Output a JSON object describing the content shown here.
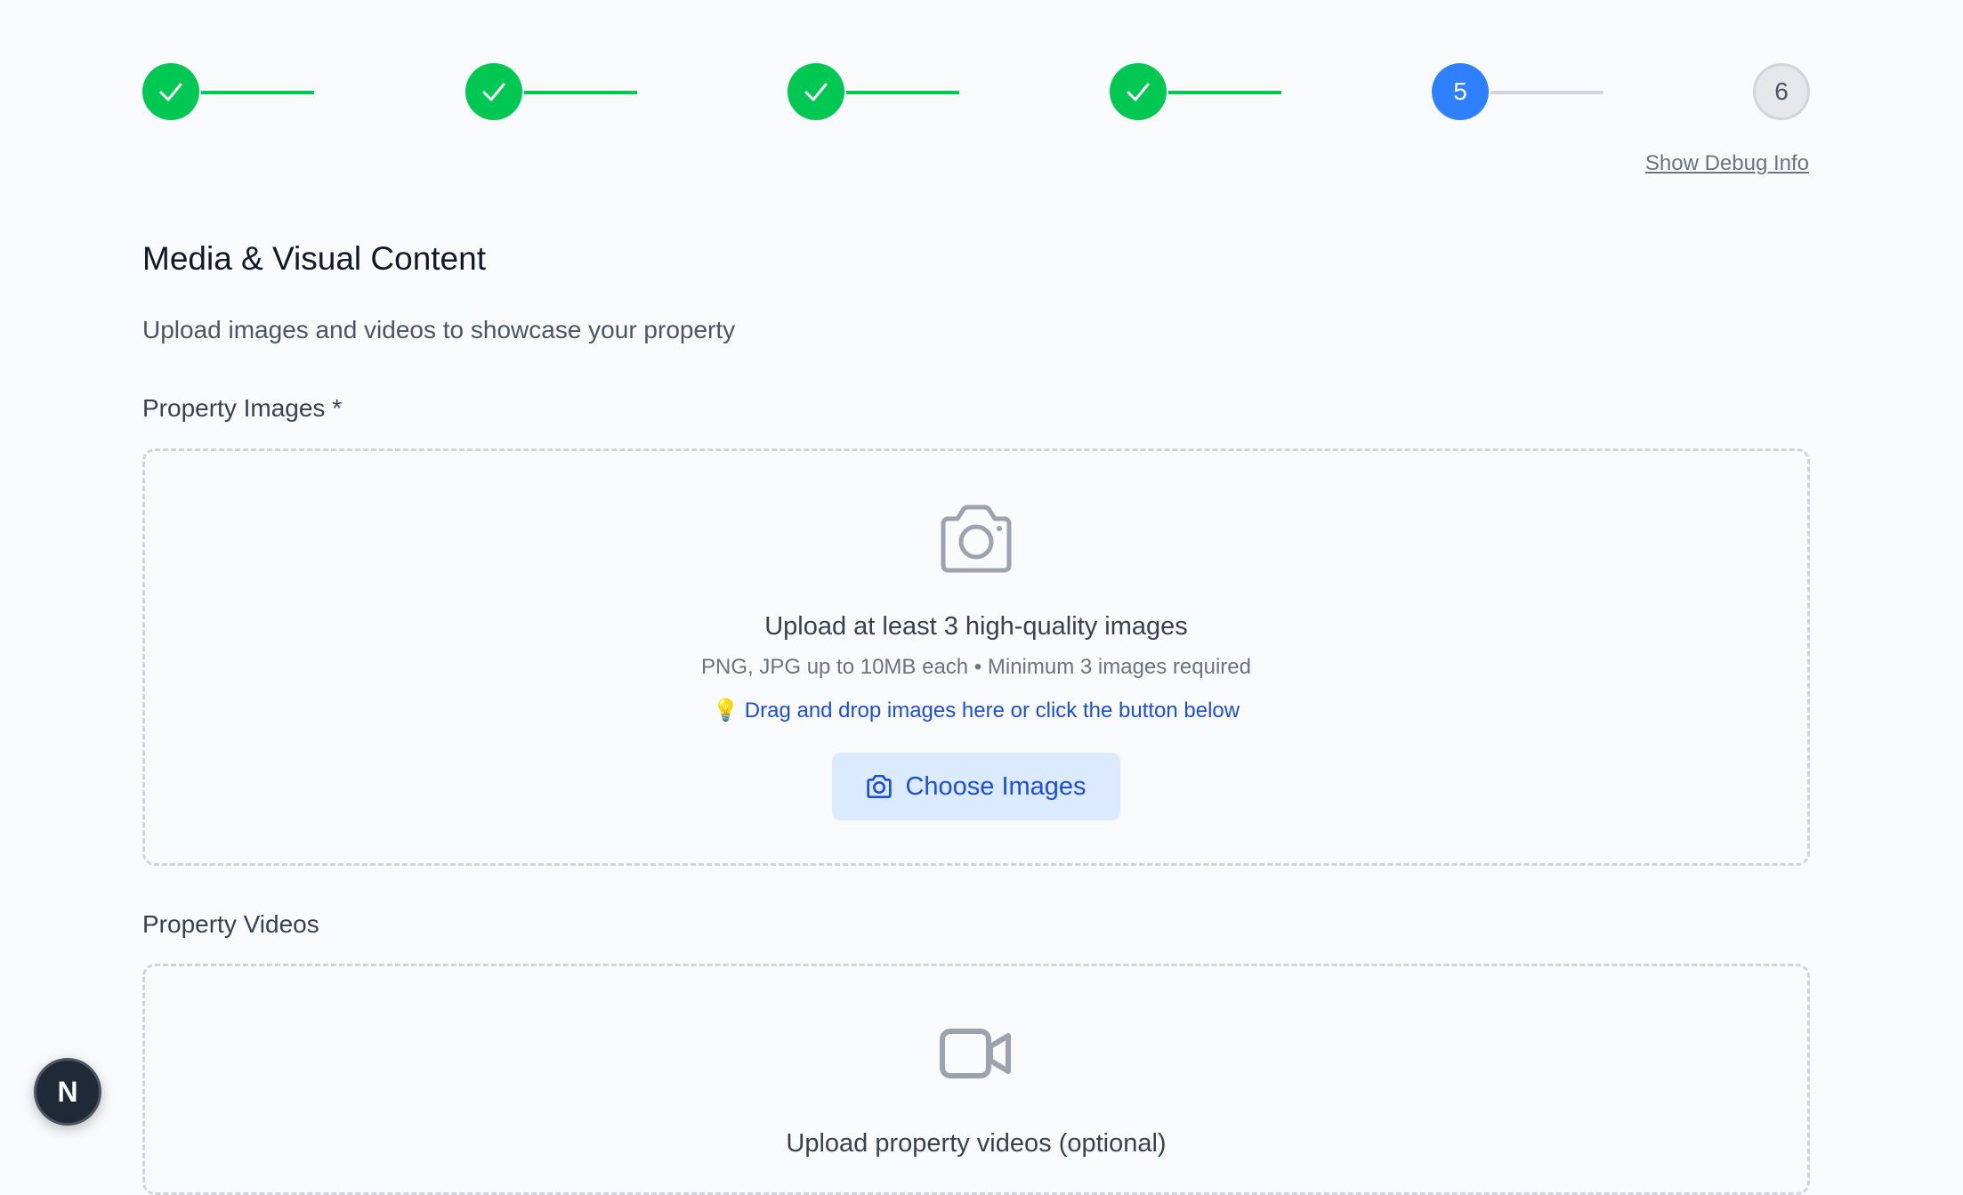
{
  "stepper": {
    "steps": [
      {
        "status": "done",
        "label": ""
      },
      {
        "status": "done",
        "label": ""
      },
      {
        "status": "done",
        "label": ""
      },
      {
        "status": "done",
        "label": ""
      },
      {
        "status": "active",
        "label": "5"
      },
      {
        "status": "pending",
        "label": "6"
      }
    ],
    "debug_link": "Show Debug Info"
  },
  "section": {
    "title": "Media & Visual Content",
    "description": "Upload images and videos to showcase your property"
  },
  "images": {
    "label": "Property Images *",
    "icon": "camera-icon",
    "title": "Upload at least 3 high-quality images",
    "subtitle": "PNG, JPG up to 10MB each • Minimum 3 images required",
    "hint_icon": "💡",
    "hint": "Drag and drop images here or click the button below",
    "button_label": "Choose Images",
    "button_icon": "camera-icon"
  },
  "videos": {
    "label": "Property Videos",
    "icon": "video-icon",
    "title": "Upload property videos (optional)"
  },
  "dev_badge": {
    "label": "N"
  },
  "colors": {
    "done": "#00c853",
    "active": "#2f80ff",
    "pending": "#e5e7eb",
    "link": "#1d4ed8",
    "button_bg": "#dbeafe"
  }
}
